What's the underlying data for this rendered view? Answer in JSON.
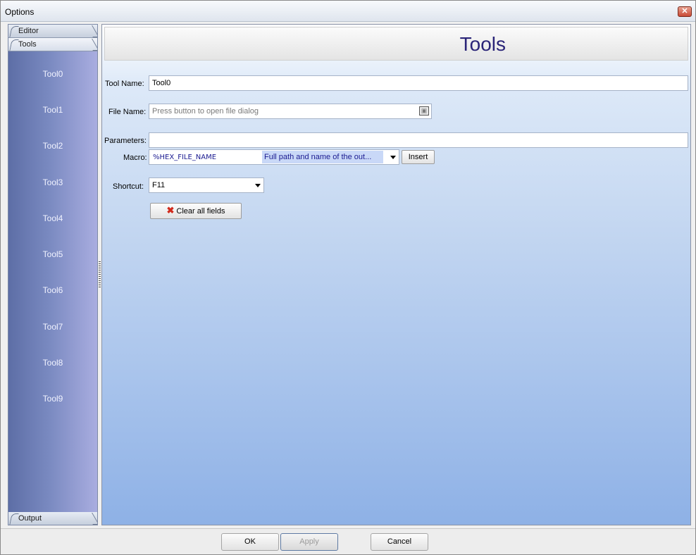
{
  "window": {
    "title": "Options",
    "close_label": "✕"
  },
  "sidebar": {
    "tabs": [
      {
        "label": "Editor"
      },
      {
        "label": "Tools"
      },
      {
        "label": "Output"
      }
    ],
    "items": [
      "Tool0",
      "Tool1",
      "Tool2",
      "Tool3",
      "Tool4",
      "Tool5",
      "Tool6",
      "Tool7",
      "Tool8",
      "Tool9"
    ]
  },
  "main": {
    "title": "Tools",
    "tool_name": {
      "label": "Tool Name:",
      "value": "Tool0"
    },
    "file_name": {
      "label": "File Name:",
      "placeholder": "Press button to open file dialog"
    },
    "parameters": {
      "label": "Parameters:",
      "value": ""
    },
    "macro": {
      "label": "Macro:",
      "value": "%HEX_FILE_NAME",
      "description": "Full path and name of the out...",
      "insert_label": "Insert"
    },
    "shortcut": {
      "label": "Shortcut:",
      "value": "F11"
    },
    "clear_label": "Clear all fields"
  },
  "footer": {
    "ok_label": "OK",
    "apply_label": "Apply",
    "cancel_label": "Cancel"
  },
  "colors": {
    "sidebar_gradient_start": "#5d6ea6",
    "sidebar_gradient_end": "#a9ade0",
    "title_color": "#2a2478",
    "panel_bottom": "#8eb1e6"
  },
  "icons": {
    "browse": "folder-open-icon",
    "clear": "red-x-icon",
    "close": "close-icon"
  }
}
